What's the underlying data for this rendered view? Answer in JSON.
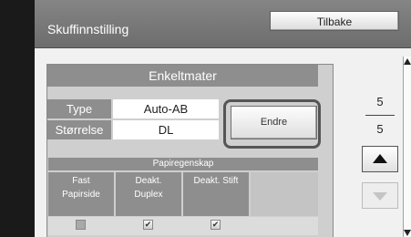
{
  "header": {
    "title": "Skuffinnstilling",
    "back_label": "Tilbake"
  },
  "panel": {
    "title": "Enkeltmater",
    "type": {
      "label": "Type",
      "value": "Auto-AB"
    },
    "size": {
      "label": "Størrelse",
      "value": "DL"
    },
    "change_label": "Endre",
    "properties_title": "Papiregenskap",
    "properties": [
      {
        "line1": "Fast",
        "line2": "Papirside",
        "checked": false
      },
      {
        "line1": "Deakt.",
        "line2": "Duplex",
        "checked": true
      },
      {
        "line1": "Deakt. Stift",
        "line2": "",
        "checked": true
      },
      {
        "line1": "",
        "line2": "",
        "checked": false
      }
    ]
  },
  "pager": {
    "current": "5",
    "total": "5"
  },
  "icons": {
    "scroll_up": "triangle-up-icon",
    "scroll_down": "triangle-down-icon",
    "check": "checkmark-icon"
  },
  "colors": {
    "header": "#7a7a7a",
    "label_bg": "#8e8e8e",
    "panel_bg": "#cfcfcf",
    "screen_bg": "#f1f1f1"
  }
}
